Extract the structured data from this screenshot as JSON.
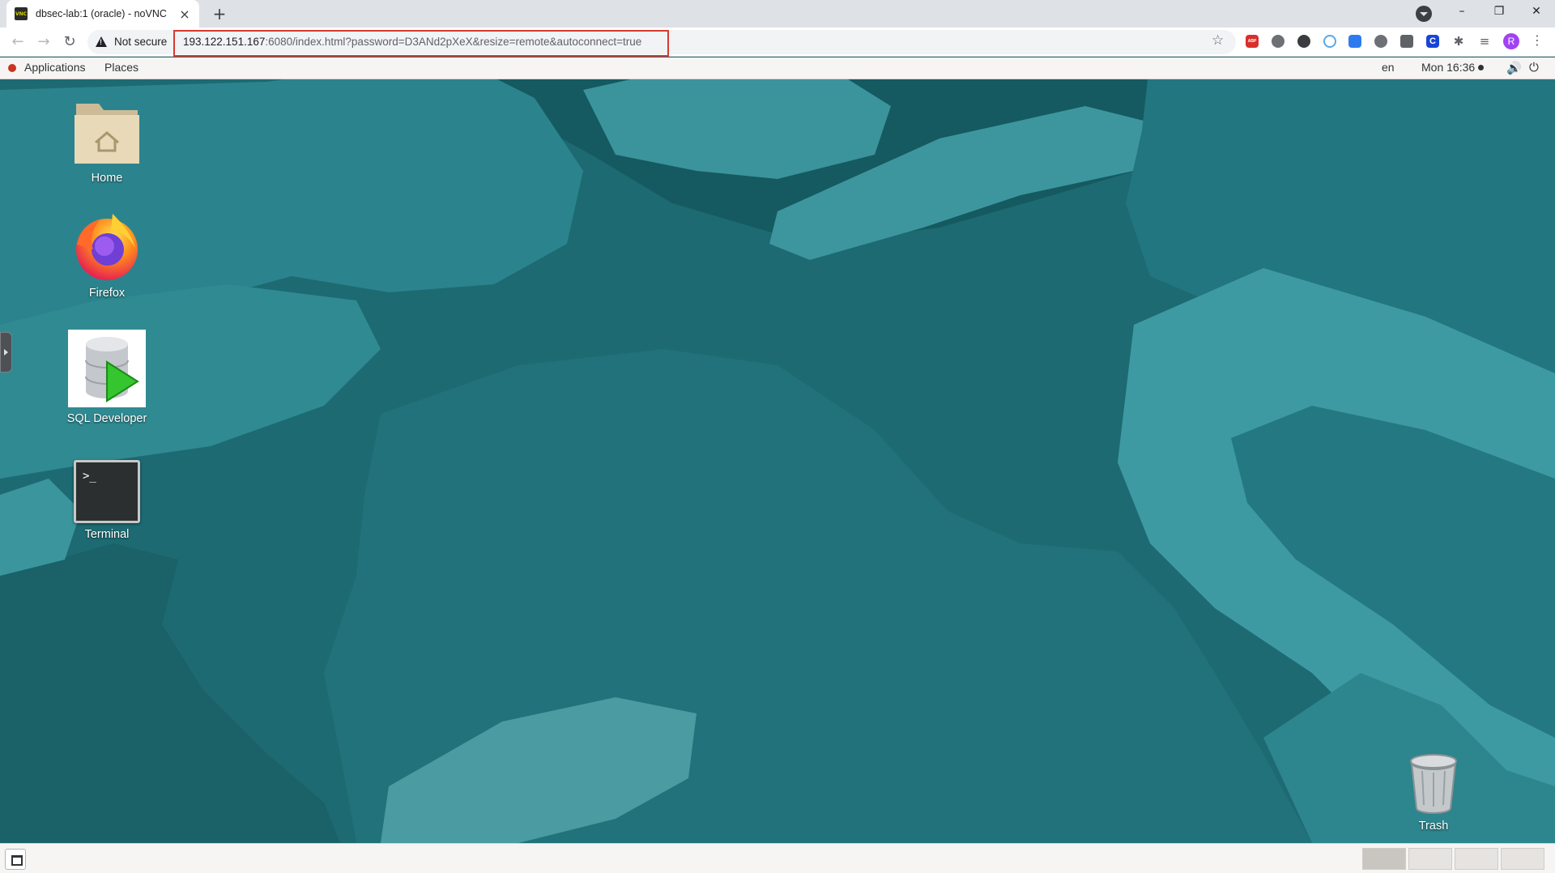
{
  "browser": {
    "tab": {
      "favicon_text": "VNC",
      "title": "dbsec-lab:1 (oracle) - noVNC",
      "close": "×"
    },
    "new_tab": "+",
    "window_controls": {
      "minimize": "–",
      "restore": "❐",
      "close": "✕"
    },
    "nav": {
      "back": "←",
      "forward": "→",
      "reload": "↻"
    },
    "security_label": "Not secure",
    "url": {
      "host": "193.122.151.167",
      "rest": ":6080/index.html?password=D3ANd2pXeX&resize=remote&autoconnect=true"
    },
    "bookmark": "☆",
    "extensions": {
      "abp_text": "ABP",
      "c_text": "C",
      "puzzle": "✱",
      "queue": "≡"
    },
    "profile_initial": "R",
    "menu": "⋮"
  },
  "gnome_topbar": {
    "applications": "Applications",
    "places": "Places",
    "language": "en",
    "clock": "Mon 16:36",
    "speaker": "🔊",
    "power": "⏻"
  },
  "desktop_icons": {
    "home": "Home",
    "firefox": "Firefox",
    "sql_developer": "SQL Developer",
    "terminal": "Terminal",
    "terminal_prompt": ">_",
    "trash": "Trash"
  },
  "workspaces": {
    "count": 4,
    "active_index": 0
  },
  "colors": {
    "wallpaper_base": "#1d6a72",
    "wallpaper_dark": "#155a60",
    "wallpaper_light": "#2d8790",
    "wallpaper_pale": "#4aa5ac",
    "highlight_border": "#d9392e",
    "profile": "#a142f4"
  }
}
